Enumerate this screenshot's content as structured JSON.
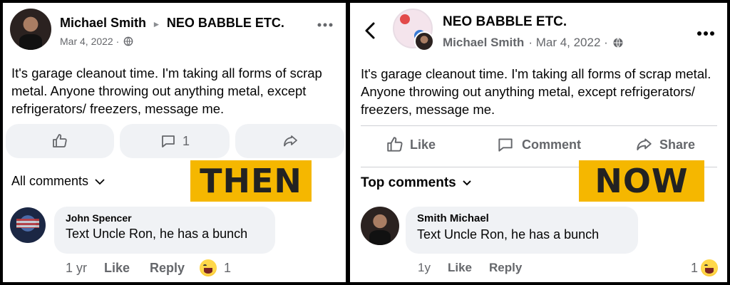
{
  "then": {
    "author": "Michael Smith",
    "group": "NEO BABBLE ETC.",
    "date": "Mar 4, 2022 ·",
    "body": "It's garage cleanout time. I'm taking all forms of scrap metal. Anyone throwing out anything metal, except refrigerators/ freezers,  message me.",
    "comment_count": "1",
    "sort_label": "All comments",
    "badge": "THEN",
    "comment": {
      "author": "John Spencer",
      "text": "Text Uncle Ron, he has a bunch",
      "age": "1 yr",
      "like": "Like",
      "reply": "Reply",
      "reactions": "1"
    }
  },
  "now": {
    "group": "NEO BABBLE ETC.",
    "author": "Michael Smith",
    "date": "· Mar 4, 2022 ·",
    "body": "It's garage cleanout time. I'm taking all forms of scrap metal. Anyone throwing out anything metal, except refrigerators/ freezers,  message me.",
    "like": "Like",
    "comment": "Comment",
    "share": "Share",
    "sort_label": "Top comments",
    "badge": "NOW",
    "reply_comment": {
      "author": "Smith Michael",
      "text": "Text Uncle Ron, he has a bunch",
      "age": "1y",
      "like": "Like",
      "reply": "Reply",
      "reactions": "1"
    }
  },
  "icons": [
    "thumbs-up-icon",
    "comment-icon",
    "share-icon",
    "chevron-down-icon",
    "globe-icon",
    "more-icon",
    "back-icon",
    "haha-emoji-icon"
  ],
  "colors": {
    "badge": "#f5b700",
    "pill": "#f0f2f5",
    "meta": "#65676b",
    "text": "#050505"
  }
}
